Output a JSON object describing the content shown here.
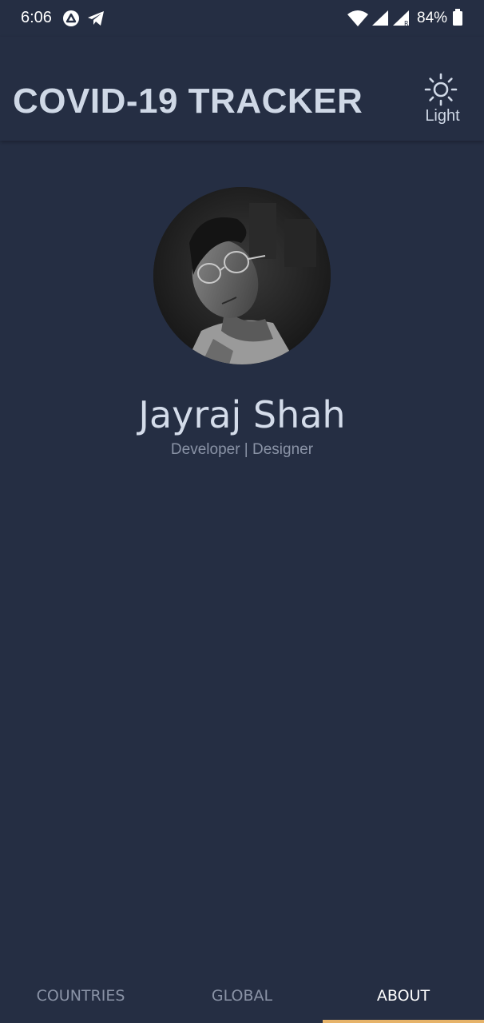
{
  "status_bar": {
    "time": "6:06",
    "battery": "84%"
  },
  "header": {
    "title": "COVID-19 TRACKER",
    "theme_toggle_label": "Light"
  },
  "profile": {
    "name": "Jayraj Shah",
    "role": "Developer | Designer"
  },
  "bottom_nav": {
    "tabs": [
      {
        "label": "COUNTRIES",
        "active": false
      },
      {
        "label": "GLOBAL",
        "active": false
      },
      {
        "label": "ABOUT",
        "active": true
      }
    ],
    "indicator_color": "#e6b36a"
  },
  "colors": {
    "background": "#252e43",
    "title": "#cfd8e6",
    "muted_text": "#8a93a6"
  }
}
